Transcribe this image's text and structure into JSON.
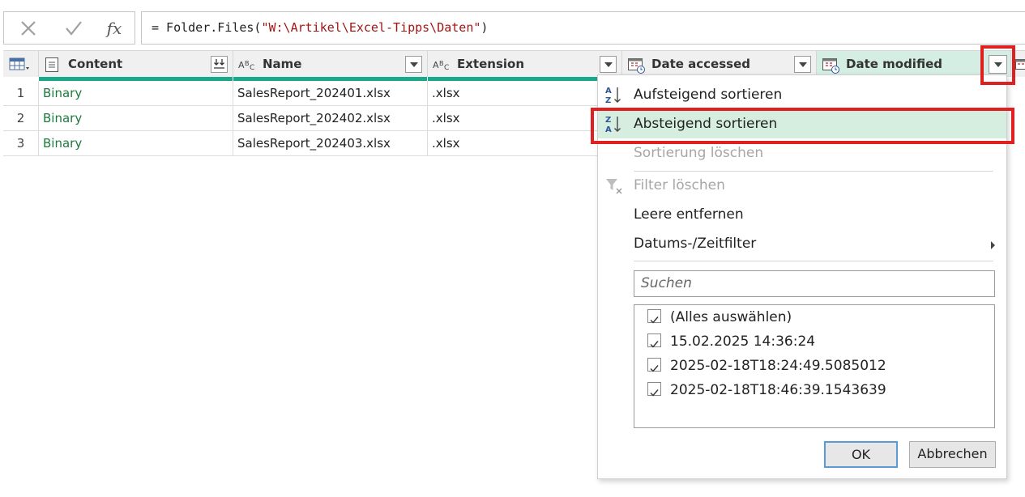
{
  "formula_bar": {
    "prefix": "= Folder.Files(",
    "argument": "\"W:\\Artikel\\Excel-Tipps\\Daten\"",
    "suffix": ")",
    "cancel_icon": "x-icon",
    "confirm_icon": "check-icon",
    "fx_label": "fx"
  },
  "columns": [
    {
      "label": "Content",
      "type_icon": "binary-icon"
    },
    {
      "label": "Name",
      "type_icon": "text-type-icon",
      "type_label": "ABC"
    },
    {
      "label": "Extension",
      "type_icon": "text-type-icon",
      "type_label": "ABC"
    },
    {
      "label": "Date accessed",
      "type_icon": "datetime-type-icon"
    },
    {
      "label": "Date modified",
      "type_icon": "datetime-type-icon"
    }
  ],
  "rows": [
    {
      "num": "1",
      "content": "Binary",
      "name": "SalesReport_202401.xlsx",
      "extension": ".xlsx"
    },
    {
      "num": "2",
      "content": "Binary",
      "name": "SalesReport_202402.xlsx",
      "extension": ".xlsx"
    },
    {
      "num": "3",
      "content": "Binary",
      "name": "SalesReport_202403.xlsx",
      "extension": ".xlsx"
    }
  ],
  "menu": {
    "sort_asc": "Aufsteigend sortieren",
    "sort_desc": "Absteigend sortieren",
    "clear_sort": "Sortierung löschen",
    "clear_filter": "Filter löschen",
    "remove_empty": "Leere entfernen",
    "datetime_filter": "Datums-/Zeitfilter",
    "search_placeholder": "Suchen",
    "values": [
      "(Alles auswählen)",
      "15.02.2025 14:36:24",
      "2025-02-18T18:24:49.5085012",
      "2025-02-18T18:46:39.1543639"
    ],
    "ok": "OK",
    "cancel": "Abbrechen"
  },
  "colors": {
    "accent_bar": "#1aa88b",
    "highlight": "#d6eedf",
    "annotation_red": "#e02020",
    "binary_text": "#1c7a3e"
  }
}
